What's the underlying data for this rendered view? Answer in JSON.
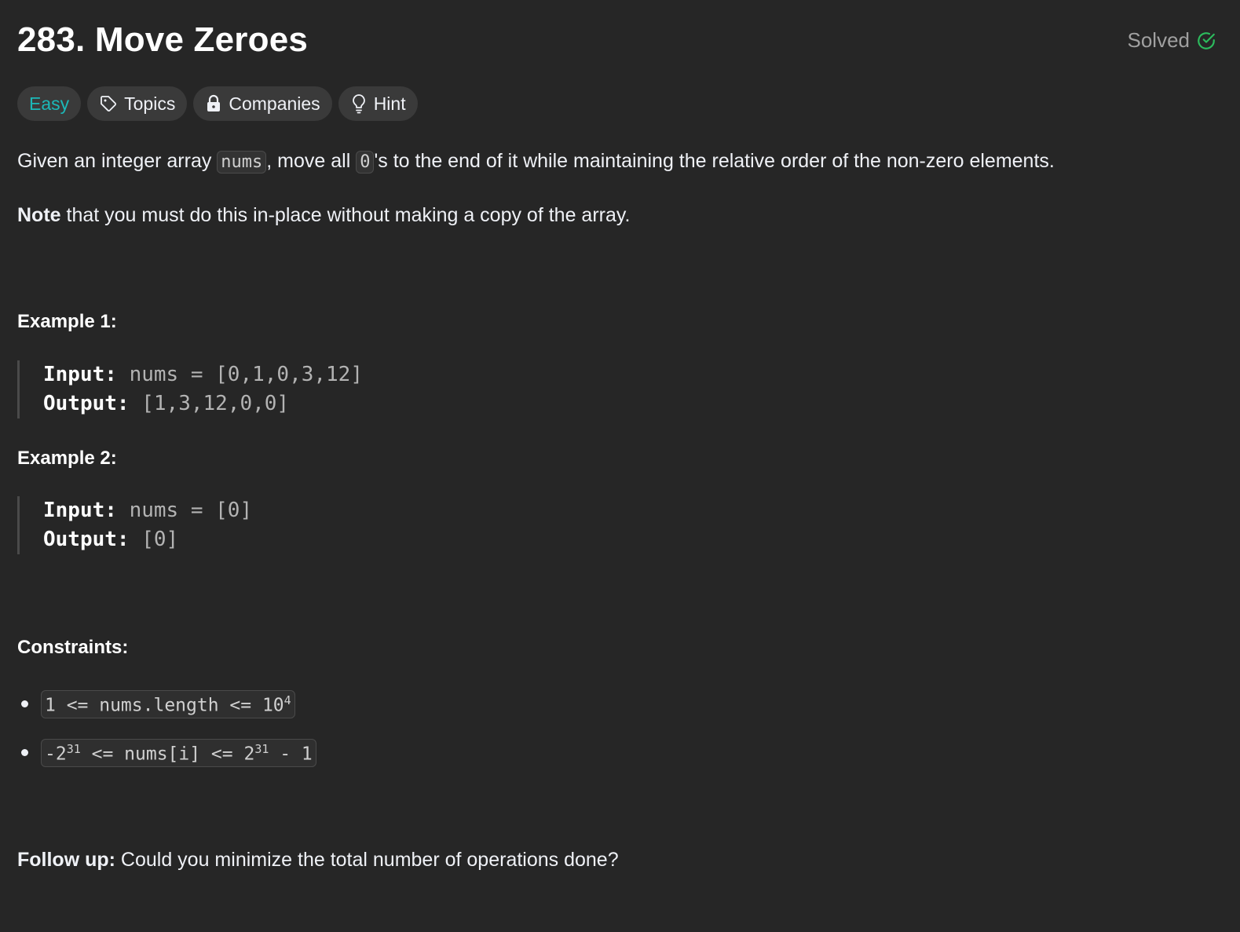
{
  "problem": {
    "title": "283. Move Zeroes",
    "status": "Solved",
    "status_color": "#2cbb5d",
    "difficulty_color": "#1cb8b8"
  },
  "tags": {
    "difficulty": "Easy",
    "topics": "Topics",
    "companies": "Companies",
    "hint": "Hint"
  },
  "description": {
    "p1_a": "Given an integer array ",
    "p1_code1": "nums",
    "p1_b": ", move all ",
    "p1_code2": "0",
    "p1_c": "'s to the end of it while maintaining the relative order of the non-zero elements.",
    "p2_bold": "Note",
    "p2_rest": " that you must do this in-place without making a copy of the array."
  },
  "examples": [
    {
      "heading": "Example 1:",
      "input_label": "Input:",
      "input_value": "nums = [0,1,0,3,12]",
      "output_label": "Output:",
      "output_value": "[1,3,12,0,0]"
    },
    {
      "heading": "Example 2:",
      "input_label": "Input:",
      "input_value": "nums = [0]",
      "output_label": "Output:",
      "output_value": "[0]"
    }
  ],
  "constraints": {
    "heading": "Constraints:",
    "c1_text": "1 <= nums.length <= 10",
    "c1_sup": "4",
    "c2_a": "-2",
    "c2_sup1": "31",
    "c2_b": " <= nums[i] <= 2",
    "c2_sup2": "31",
    "c2_c": " - 1"
  },
  "follow_up": {
    "bold": "Follow up:",
    "text": " Could you minimize the total number of operations done?"
  },
  "icons": {
    "solved": "check-circle-icon",
    "topics": "tag-icon",
    "companies": "lock-icon",
    "hint": "lightbulb-icon"
  }
}
